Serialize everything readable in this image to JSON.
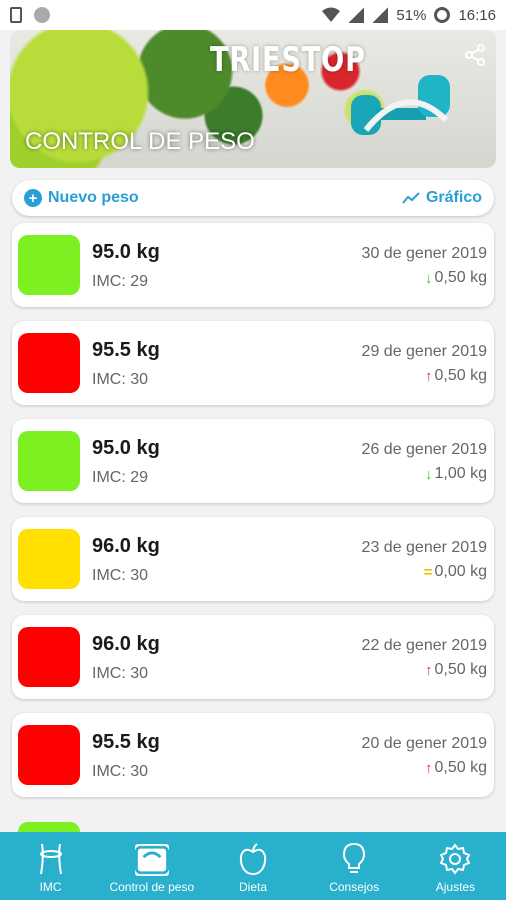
{
  "status_bar": {
    "battery": "51%",
    "time": "16:16"
  },
  "banner": {
    "brand": "TRIESTOP",
    "subtitle": "CONTROL DE PESO"
  },
  "actions": {
    "new_weight": "Nuevo peso",
    "chart": "Gráfico"
  },
  "entries": [
    {
      "weight": "95.0 kg",
      "imc": "IMC: 29",
      "date": "30 de gener 2019",
      "delta": "0,50 kg",
      "trend": "down",
      "color": "#7cf020"
    },
    {
      "weight": "95.5 kg",
      "imc": "IMC: 30",
      "date": "29 de gener 2019",
      "delta": "0,50 kg",
      "trend": "up",
      "color": "#ff0000"
    },
    {
      "weight": "95.0 kg",
      "imc": "IMC: 29",
      "date": "26 de gener 2019",
      "delta": "1,00 kg",
      "trend": "down",
      "color": "#7cf020"
    },
    {
      "weight": "96.0 kg",
      "imc": "IMC: 30",
      "date": "23 de gener 2019",
      "delta": "0,00 kg",
      "trend": "equal",
      "color": "#ffe000"
    },
    {
      "weight": "96.0 kg",
      "imc": "IMC: 30",
      "date": "22 de gener 2019",
      "delta": "0,50 kg",
      "trend": "up",
      "color": "#ff0000"
    },
    {
      "weight": "95.5 kg",
      "imc": "IMC: 30",
      "date": "20 de gener 2019",
      "delta": "0,50 kg",
      "trend": "up",
      "color": "#ff0000"
    }
  ],
  "trend_style": {
    "up": {
      "symbol": "↑",
      "color": "#e8333a"
    },
    "down": {
      "symbol": "↓",
      "color": "#4cc23a"
    },
    "equal": {
      "symbol": "=",
      "color": "#f2c300"
    }
  },
  "nav": [
    {
      "label": "IMC",
      "icon": "body-measure-icon",
      "active": false
    },
    {
      "label": "Control de peso",
      "icon": "scale-icon",
      "active": true
    },
    {
      "label": "Dieta",
      "icon": "apple-icon",
      "active": false
    },
    {
      "label": "Consejos",
      "icon": "lightbulb-icon",
      "active": false
    },
    {
      "label": "Ajustes",
      "icon": "gear-icon",
      "active": false
    }
  ],
  "colors": {
    "accent": "#2a9fd6",
    "navbar": "#29b0cc"
  }
}
